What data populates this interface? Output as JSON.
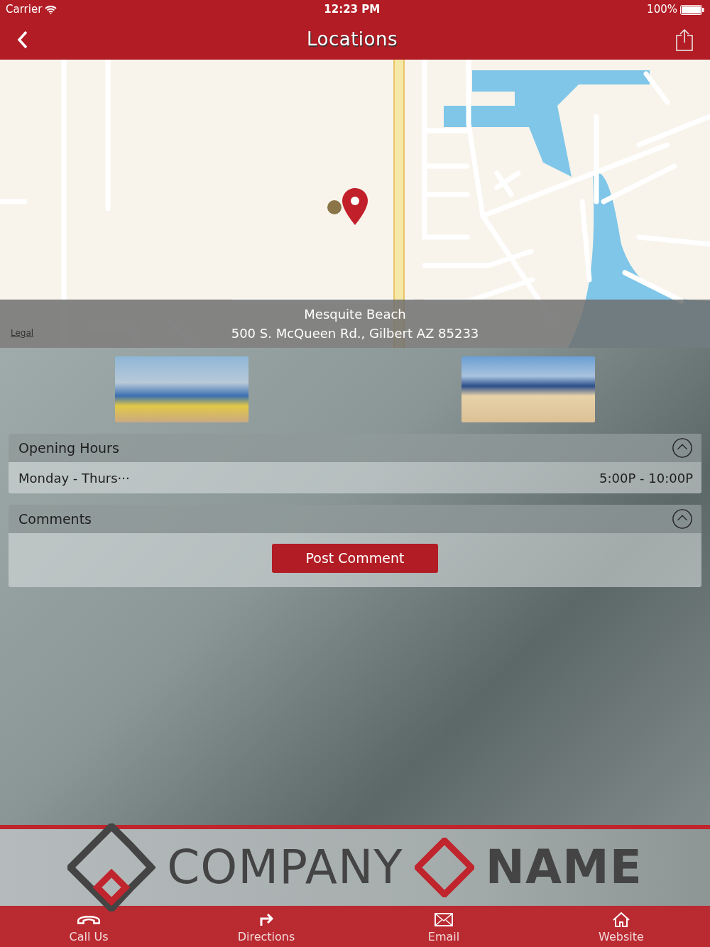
{
  "status_bar": {
    "carrier": "Carrier",
    "time": "12:23 PM",
    "battery": "100%"
  },
  "nav": {
    "title": "Locations"
  },
  "map": {
    "legal": "Legal",
    "place_name": "Mesquite Beach",
    "address": "500 S. McQueen Rd., Gilbert AZ 85233"
  },
  "sections": [
    {
      "title": "Opening Hours",
      "expanded": true,
      "kind": "hours",
      "rows": [
        {
          "day": "Monday - Thurs···",
          "hours": "5:00P - 10:00P"
        }
      ]
    },
    {
      "title": "Comments",
      "expanded": true,
      "kind": "comments",
      "button": "Post Comment"
    }
  ],
  "logo": {
    "word_1": "COMPANY",
    "word_2": "NAME"
  },
  "tab_bar": [
    {
      "label": "Call Us",
      "kind": "phone"
    },
    {
      "label": "Directions",
      "kind": "directions"
    },
    {
      "label": "Email",
      "kind": "email"
    },
    {
      "label": "Website",
      "kind": "home"
    }
  ]
}
